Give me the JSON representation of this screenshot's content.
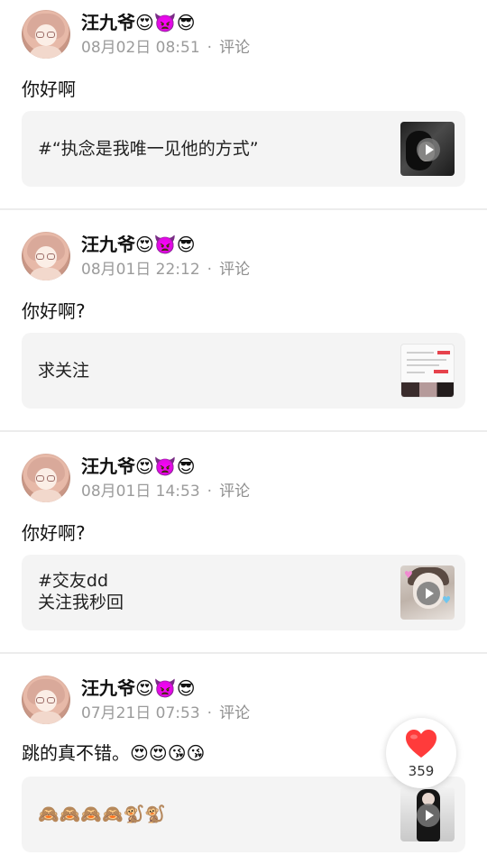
{
  "posts": [
    {
      "author": "汪九爷😍👿😎",
      "date": "08月02日 08:51",
      "separator": "·",
      "comment_label": "评论",
      "text": "你好啊",
      "card_text": "#“执念是我唯一见他的方式”",
      "thumb_type": "video"
    },
    {
      "author": "汪九爷😍👿😎",
      "date": "08月01日 22:12",
      "separator": "·",
      "comment_label": "评论",
      "text": "你好啊?",
      "card_text": "求关注",
      "thumb_type": "image"
    },
    {
      "author": "汪九爷😍👿😎",
      "date": "08月01日 14:53",
      "separator": "·",
      "comment_label": "评论",
      "text": "你好啊?",
      "card_text": "#交友dd\n关注我秒回",
      "thumb_type": "video"
    },
    {
      "author": "汪九爷😍👿😎",
      "date": "07月21日 07:53",
      "separator": "·",
      "comment_label": "评论",
      "text": "跳的真不错。😍😍😘😘",
      "card_text": "🙈🙈🙈🙈🐒🐒",
      "thumb_type": "video"
    }
  ],
  "like": {
    "count": "359",
    "icon": "heart-icon",
    "color": "#ff3b3b"
  }
}
